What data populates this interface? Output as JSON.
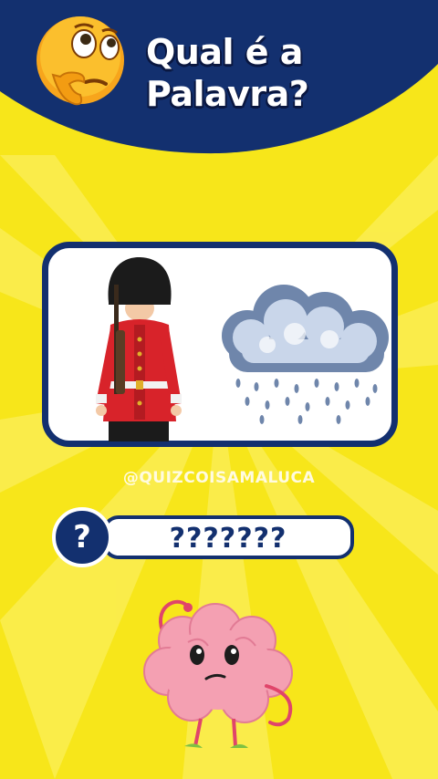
{
  "header": {
    "title_line1": "Qual é a",
    "title_line2": "Palavra?"
  },
  "quiz": {
    "clue_images": [
      "royal-guard",
      "rain-cloud"
    ],
    "handle": "@QUIZCOISAMALUCA",
    "answer_placeholder": "???????",
    "answer_badge": "?"
  },
  "colors": {
    "background": "#f7e61a",
    "navy": "#13306f",
    "white": "#ffffff"
  }
}
